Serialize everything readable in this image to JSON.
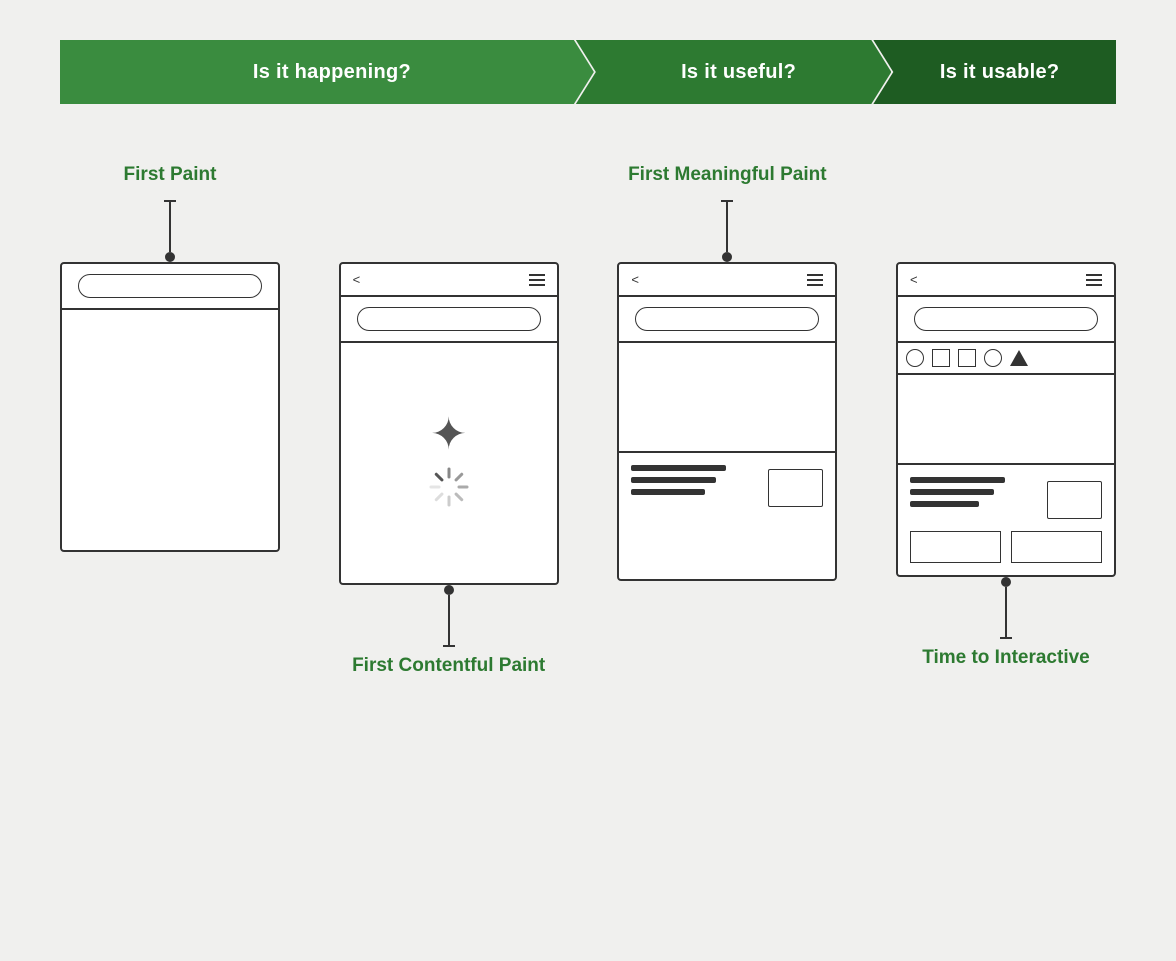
{
  "banner": {
    "seg1_label": "Is it happening?",
    "seg2_label": "Is it useful?",
    "seg3_label": "Is it usable?"
  },
  "phones": [
    {
      "id": "first-paint",
      "label_above": "First Paint",
      "label_below": null,
      "has_connector_above": true,
      "has_connector_below": false,
      "type": "empty"
    },
    {
      "id": "first-contentful-paint",
      "label_above": null,
      "label_below": "First Contentful Paint",
      "has_connector_above": false,
      "has_connector_below": true,
      "type": "loading"
    },
    {
      "id": "first-meaningful-paint",
      "label_above": "First Meaningful Paint",
      "label_below": null,
      "has_connector_above": true,
      "has_connector_below": false,
      "type": "content"
    },
    {
      "id": "time-to-interactive",
      "label_above": null,
      "label_below": "Time to Interactive",
      "has_connector_above": false,
      "has_connector_below": true,
      "type": "interactive"
    }
  ]
}
